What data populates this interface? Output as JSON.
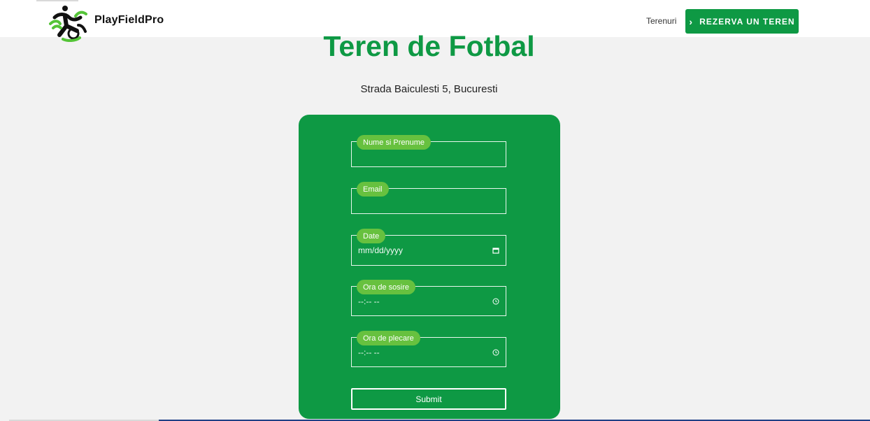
{
  "header": {
    "brand": "PlayFieldPro",
    "nav_link": "Terenuri",
    "cta_label": "REZERVA UN TEREN",
    "cta_icon": "chevron-right-icon"
  },
  "main": {
    "title": "Teren de Fotbal",
    "address": "Strada Baiculesti 5, Bucuresti"
  },
  "form": {
    "fields": [
      {
        "label": "Nume si Prenume",
        "value": ""
      },
      {
        "label": "Email",
        "value": ""
      },
      {
        "label": "Date",
        "value": "mm/dd/yyyy",
        "icon": "calendar-icon"
      },
      {
        "label": "Ora de sosire",
        "value": "--:-- --",
        "icon": "clock-icon"
      },
      {
        "label": "Ora de plecare",
        "value": "--:-- --",
        "icon": "clock-icon"
      }
    ],
    "submit_label": "Submit"
  },
  "colors": {
    "accent": "#0e9944",
    "label_pill": "#67c13f",
    "background": "#f2f2f2"
  }
}
